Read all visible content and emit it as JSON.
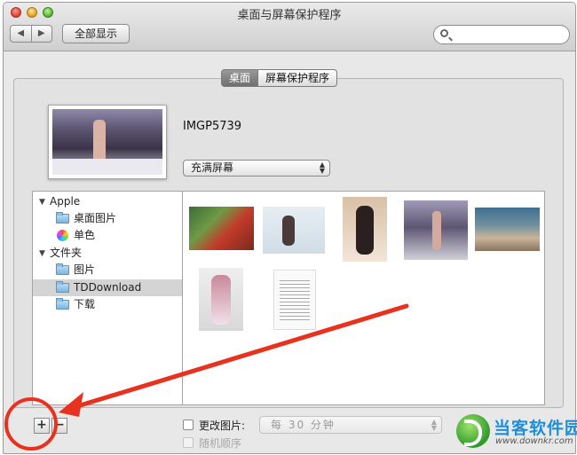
{
  "window": {
    "title": "桌面与屏幕保护程序"
  },
  "toolbar": {
    "back_glyph": "◀",
    "forward_glyph": "▶",
    "show_all_label": "全部显示",
    "search_placeholder": ""
  },
  "tabs": [
    {
      "label": "桌面",
      "selected": true
    },
    {
      "label": "屏幕保护程序",
      "selected": false
    }
  ],
  "preview": {
    "filename": "IMGP5739"
  },
  "fit_popup": {
    "value": "充满屏幕"
  },
  "sources": [
    {
      "label": "Apple",
      "kind": "group",
      "icon": "disclosure-triangle-icon"
    },
    {
      "label": "桌面图片",
      "kind": "item",
      "icon": "folder-icon"
    },
    {
      "label": "单色",
      "kind": "item",
      "icon": "color-wheel-icon"
    },
    {
      "label": "文件夹",
      "kind": "group",
      "icon": "disclosure-triangle-icon"
    },
    {
      "label": "图片",
      "kind": "item",
      "icon": "folder-icon"
    },
    {
      "label": "TDDownload",
      "kind": "item",
      "icon": "folder-icon",
      "selected": true
    },
    {
      "label": "下载",
      "kind": "item",
      "icon": "folder-icon"
    }
  ],
  "bottom": {
    "add_label": "+",
    "remove_label": "−",
    "change_picture_label": "更改图片:",
    "interval_value": "每 30 分钟",
    "random_order_label": "随机顺序"
  },
  "annotation": {
    "color": "#e8321f"
  },
  "watermark": {
    "title": "当客软件园",
    "url": "www.downkr.com"
  }
}
